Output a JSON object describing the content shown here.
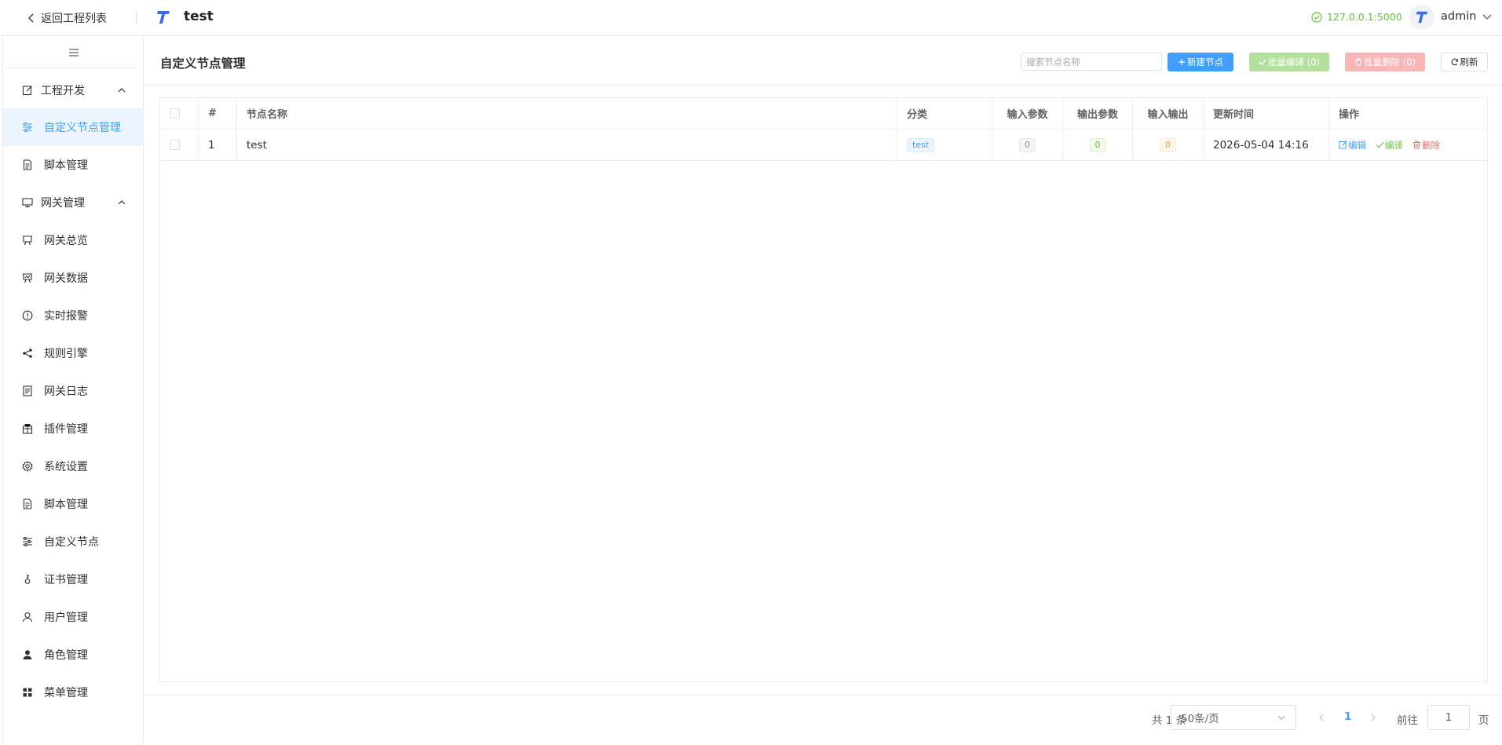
{
  "header": {
    "back_label": "返回工程列表",
    "project_title": "test",
    "server_status": "127.0.0.1:5000",
    "username": "admin"
  },
  "sidebar": {
    "groups": [
      {
        "label": "工程开发",
        "icon": "edit-icon",
        "expanded": true
      },
      {
        "label": "网关管理",
        "icon": "monitor-icon",
        "expanded": true
      }
    ],
    "items": [
      {
        "label": "自定义节点管理",
        "icon": "sliders-icon",
        "active": true
      },
      {
        "label": "脚本管理",
        "icon": "document-icon"
      },
      {
        "label": "网关总览",
        "icon": "presentation-icon"
      },
      {
        "label": "网关数据",
        "icon": "data-board-icon"
      },
      {
        "label": "实时报警",
        "icon": "warning-circle-icon"
      },
      {
        "label": "规则引擎",
        "icon": "share-icon"
      },
      {
        "label": "网关日志",
        "icon": "log-icon"
      },
      {
        "label": "插件管理",
        "icon": "package-icon"
      },
      {
        "label": "系统设置",
        "icon": "gear-icon"
      },
      {
        "label": "脚本管理",
        "icon": "document-icon"
      },
      {
        "label": "自定义节点",
        "icon": "sliders-icon"
      },
      {
        "label": "证书管理",
        "icon": "key-icon"
      },
      {
        "label": "用户管理",
        "icon": "user-icon"
      },
      {
        "label": "角色管理",
        "icon": "user-filled-icon"
      },
      {
        "label": "菜单管理",
        "icon": "grid-icon"
      }
    ]
  },
  "main": {
    "title": "自定义节点管理",
    "search_placeholder": "搜索节点名称",
    "buttons": {
      "new_node": "新建节点",
      "batch_compile": "批量编译 (0)",
      "batch_delete": "批量删除 (0)",
      "refresh": "刷新"
    },
    "table": {
      "columns": [
        "#",
        "节点名称",
        "分类",
        "输入参数",
        "输出参数",
        "输入输出",
        "更新时间",
        "操作"
      ],
      "rows": [
        {
          "index": "1",
          "name": "test",
          "category": "test",
          "inputs": "0",
          "outputs": "0",
          "io": "0",
          "updated": "2026-05-04 14:16",
          "actions": {
            "edit": "编辑",
            "compile": "编译",
            "delete": "删除"
          }
        }
      ]
    },
    "pagination": {
      "total": "共 1 条",
      "page_size": "50条/页",
      "current_page": "1",
      "goto_label": "前往",
      "goto_value": "1",
      "page_unit": "页"
    }
  },
  "colors": {
    "primary": "#409eff",
    "success": "#67c23a",
    "danger": "#f56c6c",
    "warning": "#e6a23c"
  }
}
